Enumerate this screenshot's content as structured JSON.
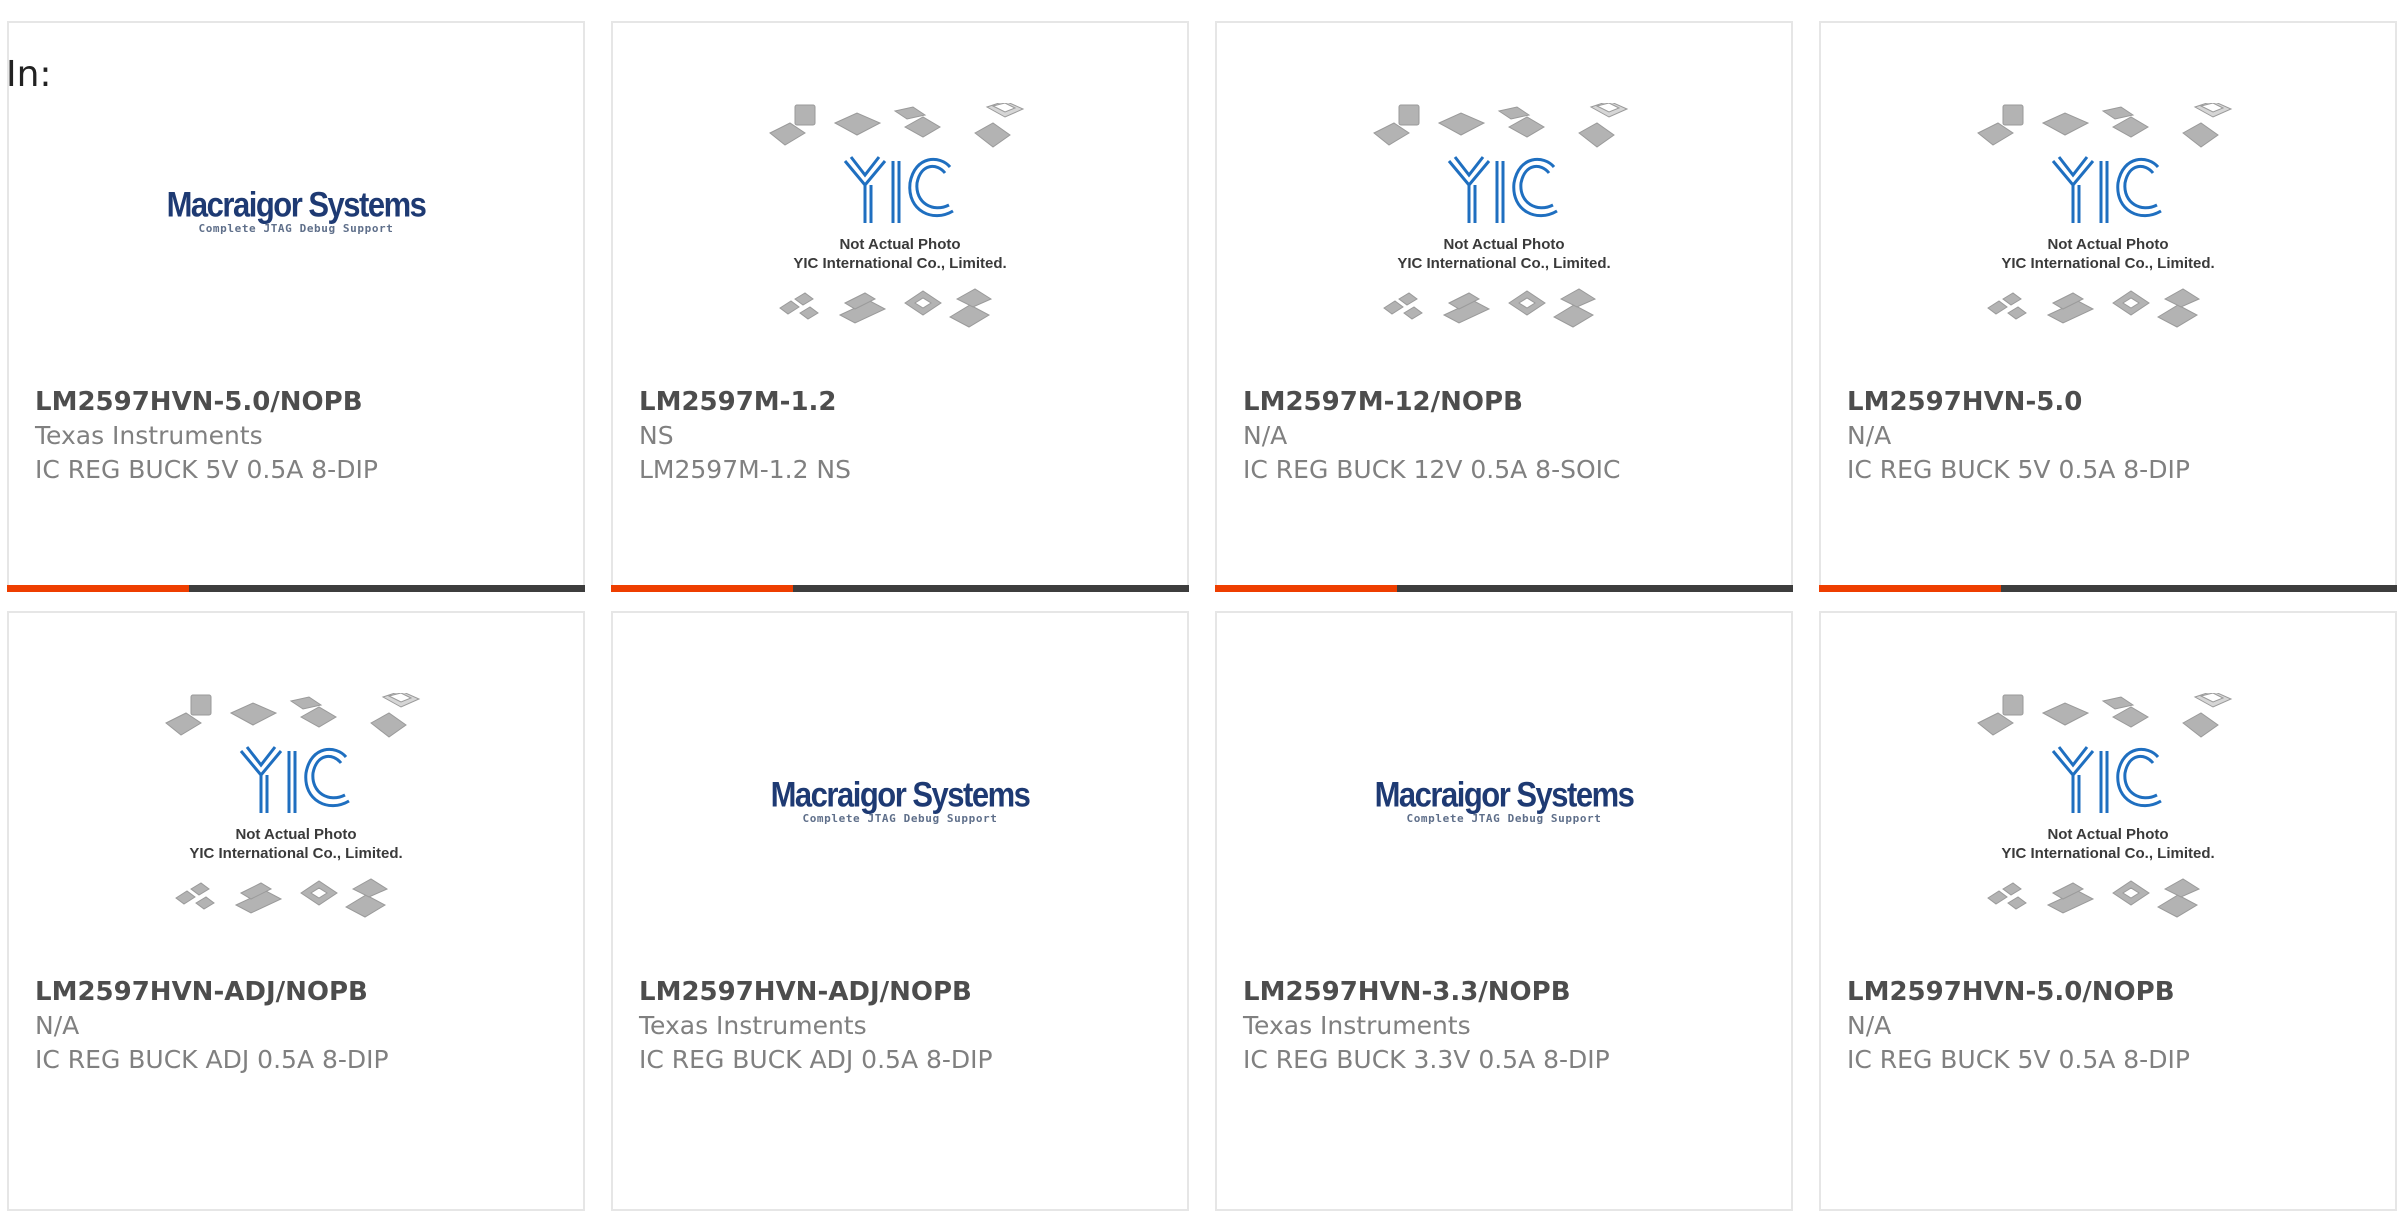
{
  "filter_label": "In:",
  "colors": {
    "accent": "#ee3e00",
    "bar_dark": "#3d3d3d",
    "macraigor_blue": "#1e3a73",
    "yic_blue": "#1f6fc0"
  },
  "products": [
    {
      "part": "LM2597HVN-5.0/NOPB",
      "manufacturer": "Texas Instruments",
      "description": "IC REG BUCK 5V 0.5A 8-DIP",
      "image": "macraigor",
      "image_text": {
        "brand": "Macraigor Systems",
        "tagline": "Complete JTAG Debug Support"
      }
    },
    {
      "part": "LM2597M-1.2",
      "manufacturer": "NS",
      "description": "LM2597M-1.2 NS",
      "image": "yic",
      "image_text": {
        "line1": "Not Actual Photo",
        "line2": "YIC International Co., Limited."
      }
    },
    {
      "part": "LM2597M-12/NOPB",
      "manufacturer": "N/A",
      "description": "IC REG BUCK 12V 0.5A 8-SOIC",
      "image": "yic",
      "image_text": {
        "line1": "Not Actual Photo",
        "line2": "YIC International Co., Limited."
      }
    },
    {
      "part": "LM2597HVN-5.0",
      "manufacturer": "N/A",
      "description": "IC REG BUCK 5V 0.5A 8-DIP",
      "image": "yic",
      "image_text": {
        "line1": "Not Actual Photo",
        "line2": "YIC International Co., Limited."
      }
    },
    {
      "part": "LM2597HVN-ADJ/NOPB",
      "manufacturer": "N/A",
      "description": "IC REG BUCK ADJ 0.5A 8-DIP",
      "image": "yic",
      "image_text": {
        "line1": "Not Actual Photo",
        "line2": "YIC International Co., Limited."
      }
    },
    {
      "part": "LM2597HVN-ADJ/NOPB",
      "manufacturer": "Texas Instruments",
      "description": "IC REG BUCK ADJ 0.5A 8-DIP",
      "image": "macraigor",
      "image_text": {
        "brand": "Macraigor Systems",
        "tagline": "Complete JTAG Debug Support"
      }
    },
    {
      "part": "LM2597HVN-3.3/NOPB",
      "manufacturer": "Texas Instruments",
      "description": "IC REG BUCK 3.3V 0.5A 8-DIP",
      "image": "macraigor",
      "image_text": {
        "brand": "Macraigor Systems",
        "tagline": "Complete JTAG Debug Support"
      }
    },
    {
      "part": "LM2597HVN-5.0/NOPB",
      "manufacturer": "N/A",
      "description": "IC REG BUCK 5V 0.5A 8-DIP",
      "image": "yic",
      "image_text": {
        "line1": "Not Actual Photo",
        "line2": "YIC International Co., Limited."
      }
    }
  ]
}
